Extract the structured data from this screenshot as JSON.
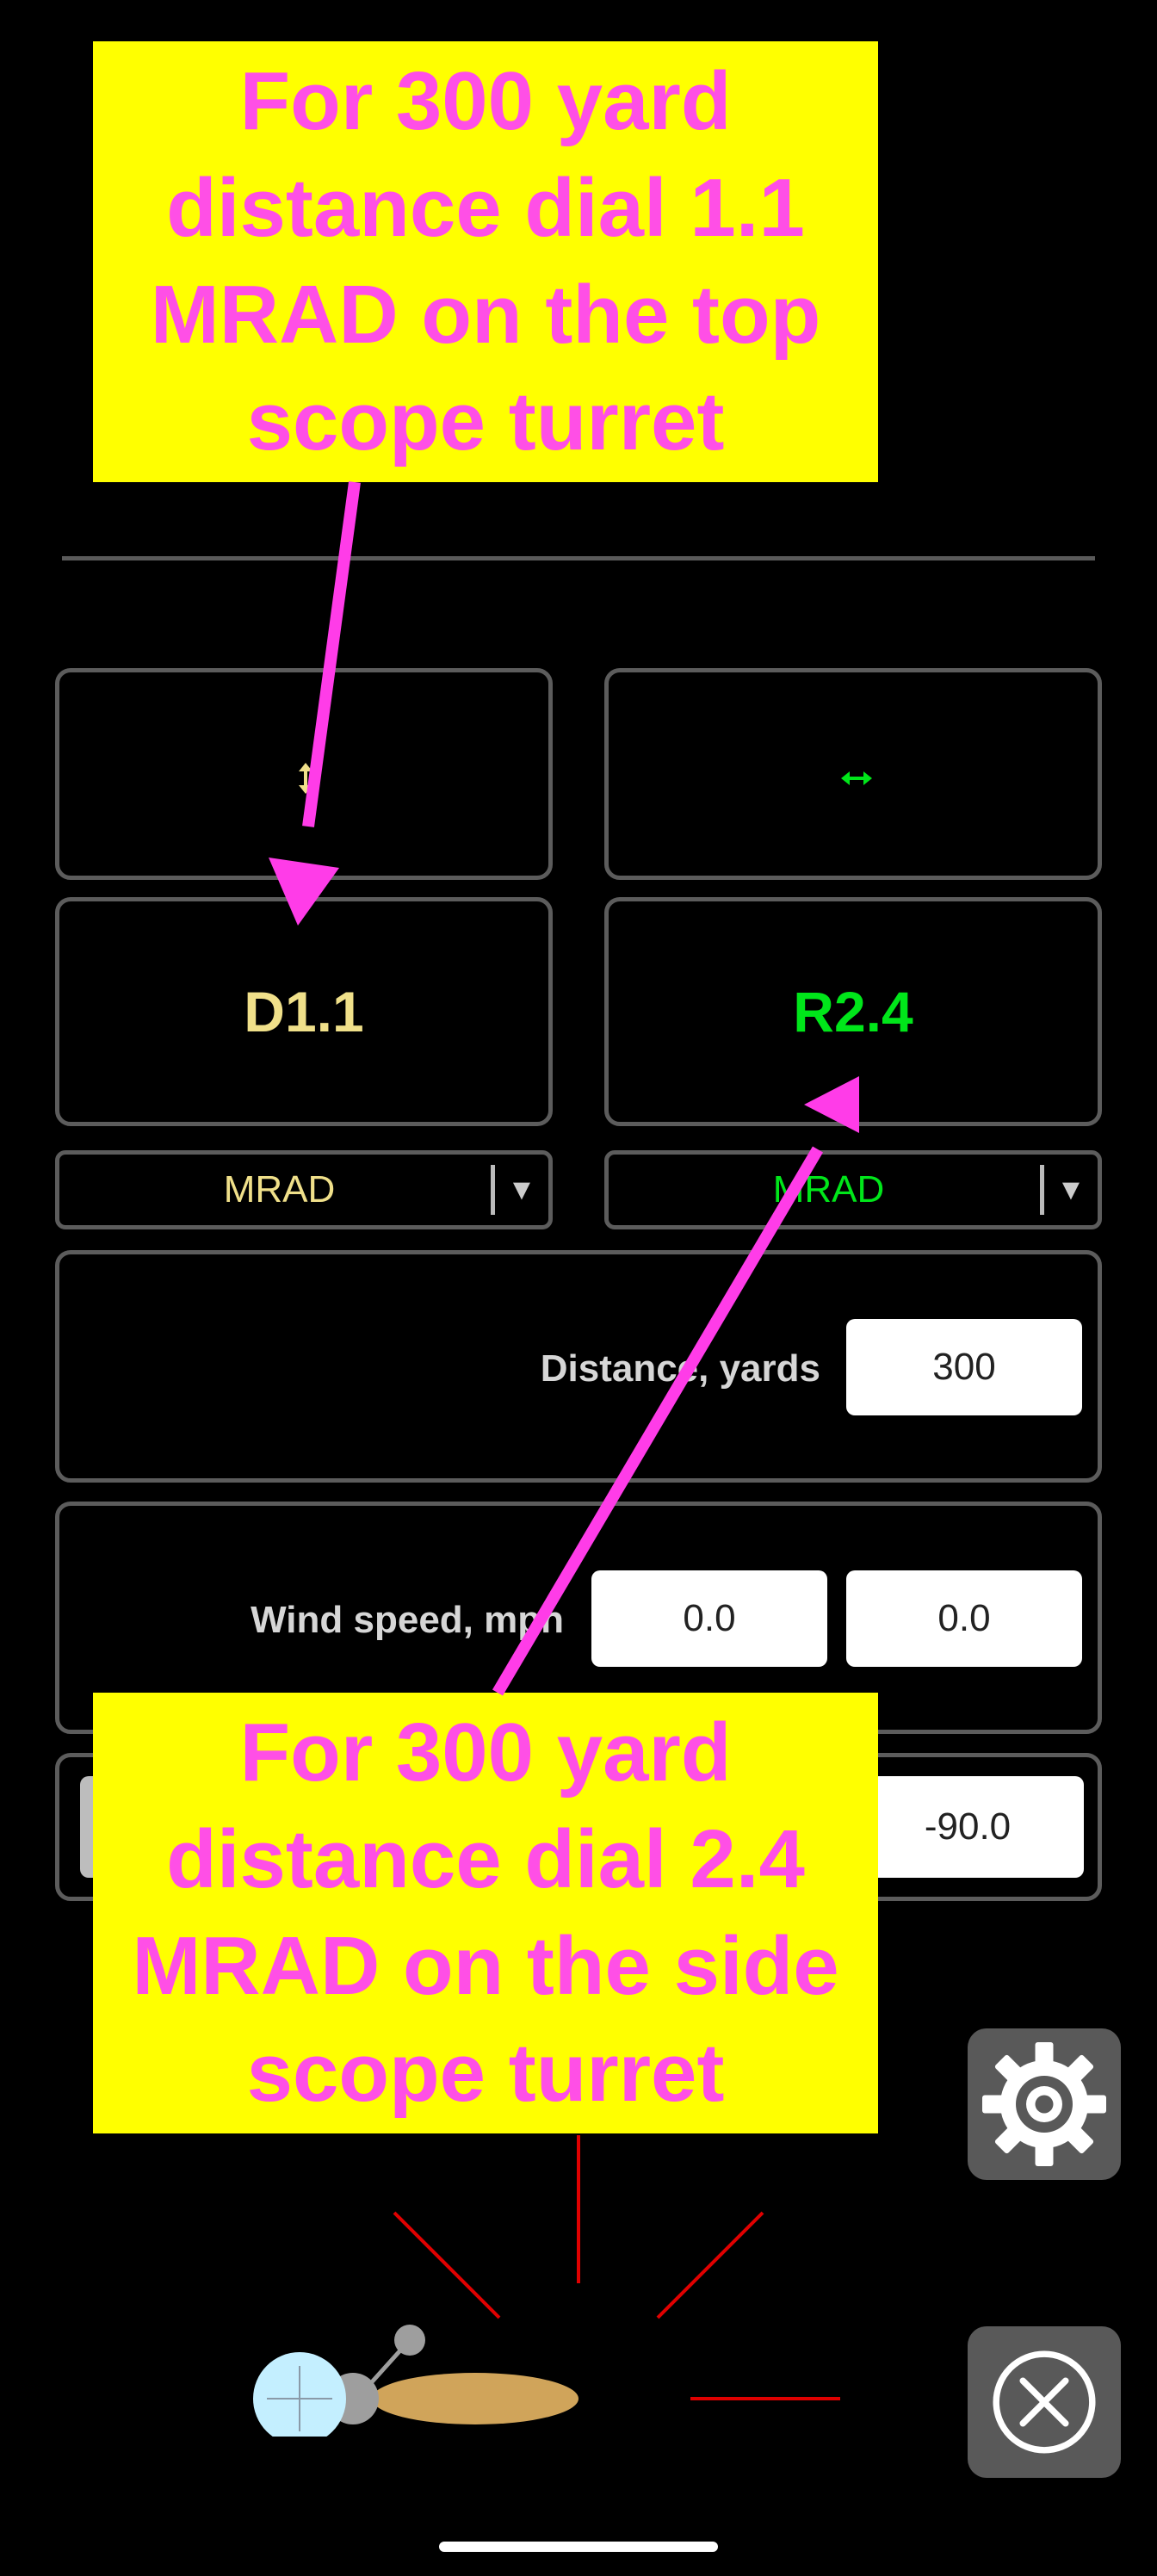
{
  "callouts": {
    "top": "For 300 yard\ndistance dial 1.1\nMRAD on the top\nscope turret",
    "bottom": "For 300 yard\ndistance dial 2.4\nMRAD on the side\nscope turret"
  },
  "elevation": {
    "icon": "vertical-arrows-icon",
    "value": "D1.1",
    "unit": "MRAD"
  },
  "windage": {
    "icon": "horizontal-arrows-icon",
    "value": "R2.4",
    "unit": "MRAD"
  },
  "distance": {
    "label": "Distance, yards",
    "value": "300"
  },
  "wind": {
    "label": "Wind speed, mph",
    "value1": "0.0",
    "value2": "0.0"
  },
  "angle": {
    "value": "-90.0"
  },
  "colors": {
    "callout_bg": "#ffff00",
    "callout_text": "#ff4fe6",
    "elevation": "#f0e08a",
    "windage": "#00e61a",
    "arrow": "#ff3ce8"
  }
}
